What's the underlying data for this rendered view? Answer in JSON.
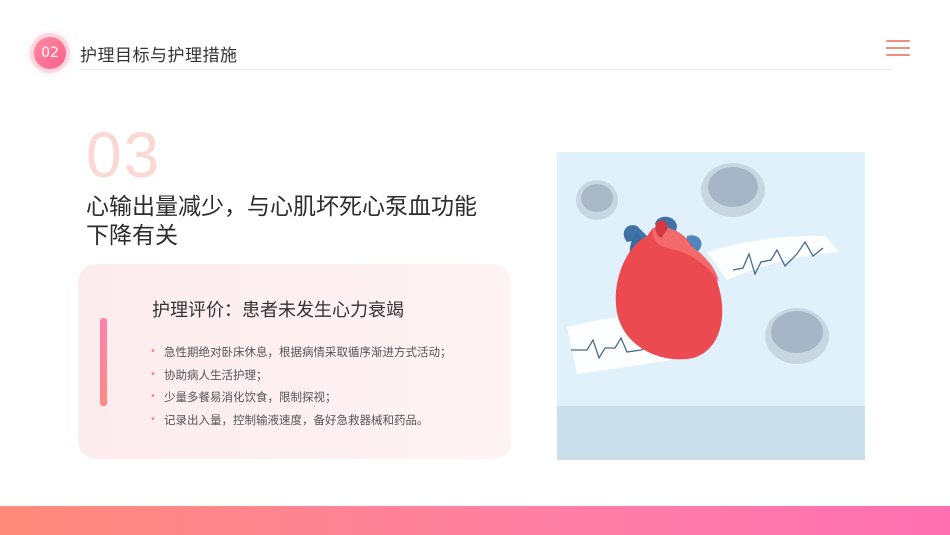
{
  "header": {
    "badge_number": "02",
    "section_title": "护理目标与护理措施"
  },
  "main": {
    "big_number": "03",
    "diagnosis_line1": "心输出量减少，与心肌坏死心泵血功能",
    "diagnosis_line2": "下降有关"
  },
  "card": {
    "title": "护理评价：患者未发生心力衰竭",
    "bullet_glyph": "•",
    "measures": [
      "急性期绝对卧床休息，根据病情采取循序渐进方式活动；",
      "协助病人生活护理；",
      "少量多餐易消化饮食，限制探视；",
      "记录出入量，控制输液速度，备好急救器械和药品。"
    ]
  },
  "icons": {
    "menu": "hamburger-menu-icon",
    "illustration": "heart-ecg-illustration"
  },
  "colors": {
    "accent": "#f28b82",
    "badge": "#ff6f8f",
    "big_number": "#fbd8d3",
    "card_bg": "#fdecee",
    "illustration_bg": "#e1f1fc",
    "bottom_band_start": "#ff8a7a",
    "bottom_band_end": "#ff6fb0"
  }
}
